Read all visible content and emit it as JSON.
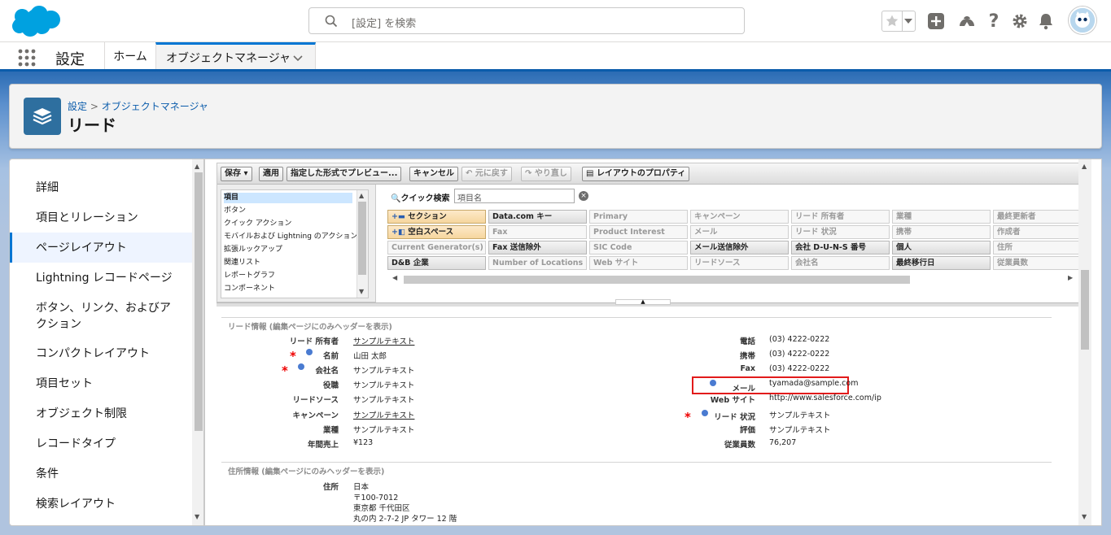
{
  "header": {
    "search_placeholder": "[設定] を検索",
    "icons": [
      "star-icon",
      "add-icon",
      "trailhead-icon",
      "help-icon",
      "gear-icon",
      "bell-icon",
      "avatar"
    ]
  },
  "nav": {
    "app_title": "設定",
    "tabs": [
      {
        "label": "ホーム"
      },
      {
        "label": "オブジェクトマネージャ"
      }
    ]
  },
  "page_header": {
    "breadcrumb": [
      "設定",
      "オブジェクトマネージャ"
    ],
    "breadcrumb_sep": ">",
    "title": "リード"
  },
  "sidebar": {
    "items": [
      {
        "label": "詳細"
      },
      {
        "label": "項目とリレーション"
      },
      {
        "label": "ページレイアウト"
      },
      {
        "label": "Lightning レコードページ"
      },
      {
        "label": "ボタン、リンク、およびア"
      },
      {
        "label": "クション"
      },
      {
        "label": "コンパクトレイアウト"
      },
      {
        "label": "項目セット"
      },
      {
        "label": "オブジェクト制限"
      },
      {
        "label": "レコードタイプ"
      },
      {
        "label": "条件"
      },
      {
        "label": "検索レイアウト"
      }
    ],
    "active_index": 2
  },
  "toolbar": {
    "save": "保存",
    "apply": "適用",
    "preview": "指定した形式でプレビュー...",
    "cancel": "キャンセル",
    "undo": "元に戻す",
    "redo": "やり直し",
    "properties": "レイアウトのプロパティ"
  },
  "palette": {
    "categories": [
      "項目",
      "ボタン",
      "クイック アクション",
      "モバイルおよび Lightning のアクション",
      "拡張ルックアップ",
      "関連リスト",
      "レポートグラフ",
      "コンポーネント"
    ],
    "quick_search_label": "クイック検索",
    "quick_search_placeholder": "項目名",
    "fields": [
      [
        "セクション",
        "Data.com キー",
        "Primary",
        "キャンペーン",
        "リード 所有者",
        "業種",
        "最終更新者"
      ],
      [
        "空白スペース",
        "Fax",
        "Product Interest",
        "メール",
        "リード 状況",
        "携帯",
        "作成者"
      ],
      [
        "Current Generator(s)",
        "Fax 送信除外",
        "SIC Code",
        "メール送信除外",
        "会社 D-U-N-S 番号",
        "個人",
        "住所"
      ],
      [
        "D&B 企業",
        "Number of Locations",
        "Web サイト",
        "リードソース",
        "会社名",
        "最終移行日",
        "従業員数"
      ]
    ]
  },
  "layout": {
    "section1_title": "リード情報 (編集ページにのみヘッダーを表示)",
    "section2_title": "住所情報 (編集ページにのみヘッダーを表示)",
    "left_fields": [
      {
        "label": "リード 所有者",
        "value": "サンプルテキスト",
        "link": true
      },
      {
        "label": "名前",
        "value": "山田 太郎"
      },
      {
        "label": "会社名",
        "value": "サンプルテキスト"
      },
      {
        "label": "役職",
        "value": "サンプルテキスト"
      },
      {
        "label": "リードソース",
        "value": "サンプルテキスト"
      },
      {
        "label": "キャンペーン",
        "value": "サンプルテキスト",
        "link": true
      },
      {
        "label": "業種",
        "value": "サンプルテキスト"
      },
      {
        "label": "年間売上",
        "value": "¥123"
      }
    ],
    "right_fields": [
      {
        "label": "電話",
        "value": "(03) 4222-0222"
      },
      {
        "label": "携帯",
        "value": "(03) 4222-0222"
      },
      {
        "label": "Fax",
        "value": "(03) 4222-0222"
      },
      {
        "label": "メール",
        "value": "tyamada@sample.com"
      },
      {
        "label": "Web サイト",
        "value": "http://www.salesforce.com/ip"
      },
      {
        "label": "リード 状況",
        "value": "サンプルテキスト"
      },
      {
        "label": "評価",
        "value": "サンプルテキスト"
      },
      {
        "label": "従業員数",
        "value": "76,207"
      }
    ],
    "address_label": "住所",
    "address_lines": [
      "日本",
      "〒100-7012",
      "東京都 千代田区",
      "丸の内 2-7-2 JP タワー 12 階"
    ],
    "required_mark": "*"
  },
  "colors": {
    "brand": "#0176d3",
    "highlight_box": "#e21b1b",
    "required": "#ee0000"
  }
}
